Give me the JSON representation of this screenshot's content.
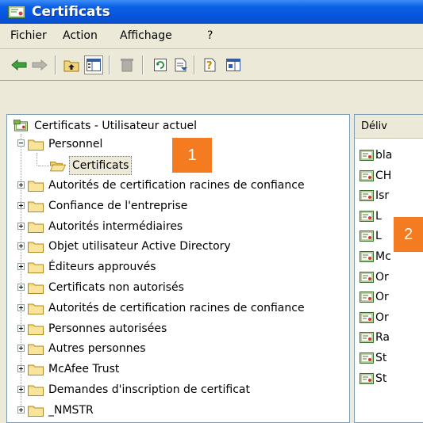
{
  "window": {
    "title": "Certificats"
  },
  "menu": [
    "Fichier",
    "Action",
    "Affichage",
    "?"
  ],
  "toolbar": [
    "back-arrow-icon",
    "forward-arrow-icon",
    "up-folder-icon",
    "show-tree-icon",
    "delete-icon",
    "refresh-icon",
    "export-list-icon",
    "help-icon",
    "action-pane-icon"
  ],
  "tree": {
    "root": "Certificats - Utilisateur actuel",
    "personnel": "Personnel",
    "selected": "Certificats",
    "items": [
      "Autorités de certification racines de confiance",
      "Confiance de l'entreprise",
      "Autorités intermédiaires",
      "Objet utilisateur Active Directory",
      "Éditeurs approuvés",
      "Certificats non autorisés",
      "Autorités de certification racines de confiance",
      "Personnes autorisées",
      "Autres personnes",
      "McAfee Trust",
      "Demandes d'inscription de certificat",
      "_NMSTR"
    ]
  },
  "list": {
    "column": "Déliv",
    "rows": [
      "bla",
      "CH",
      "Isr",
      "L",
      "L",
      "Mc",
      "Or",
      "Or",
      "Or",
      "Ra",
      "St",
      "St"
    ]
  },
  "badges": [
    "1",
    "2"
  ],
  "colors": {
    "badge": "#f47b20",
    "titlebar": "#0654dc",
    "chrome": "#ece9d8"
  }
}
